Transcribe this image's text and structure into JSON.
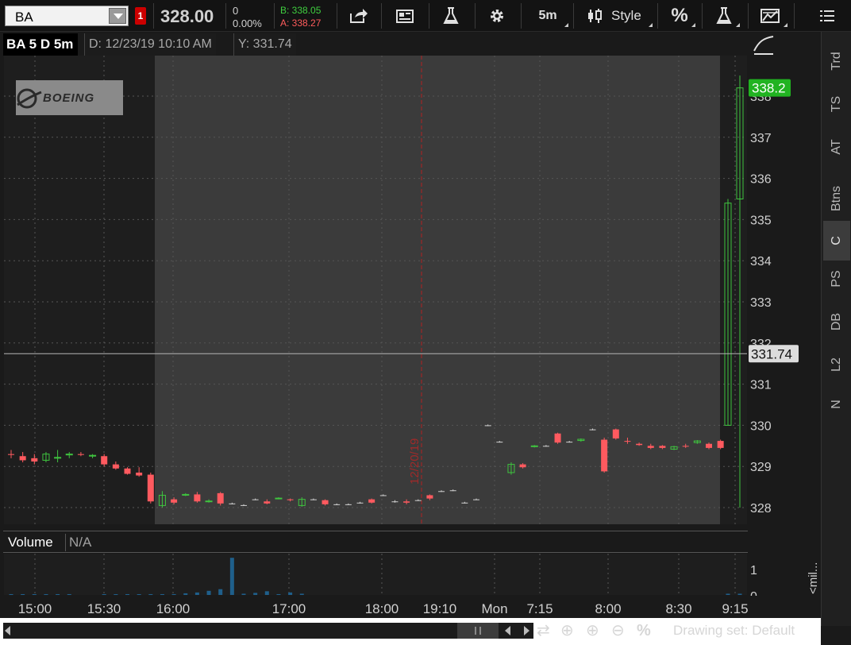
{
  "toolbar": {
    "symbol": "BA",
    "alert_count": "1",
    "last_price": "328.00",
    "net_change": "0",
    "pct_change": "0.00%",
    "bid": "B: 338.05",
    "ask": "A: 338.27",
    "timeframe_label": "5m",
    "style_label": "Style",
    "percent_label": "%",
    "icons": [
      "share-icon",
      "news-icon",
      "flask-icon",
      "gear-icon",
      "candlestick-icon",
      "percent-icon",
      "studies-icon",
      "drawings-icon",
      "menu-icon"
    ]
  },
  "chart_header": {
    "title": "BA 5 D 5m",
    "date_readout": "D: 12/23/19 10:10 AM",
    "y_readout": "Y: 331.74"
  },
  "price_panel": {
    "logo_text": "BOEING",
    "date_marker": "12/20/19",
    "last_price_label": "338.2",
    "cursor_price_label": "331.74",
    "colors": {
      "up": "#3fc43f",
      "down": "#ff5a5f",
      "last_price_bg": "#21b321",
      "cursor_label_bg": "#dcdcdc"
    }
  },
  "volume_panel": {
    "title": "Volume",
    "value": "N/A",
    "y_tick_labels": [
      "1",
      "0"
    ],
    "units_label": "<mil..."
  },
  "sidebar": {
    "tabs": [
      "Trd",
      "TS",
      "AT",
      "Btns",
      "C",
      "PS",
      "DB",
      "L2",
      "N"
    ],
    "active_tab": "C"
  },
  "bottom_bar": {
    "drawing_set_label": "Drawing set: Default",
    "icons": [
      "pan-icon",
      "crosshair-icon",
      "zoom-in-icon",
      "zoom-out-icon",
      "percent-icon"
    ]
  },
  "chart_data": {
    "type": "candlestick",
    "title": "",
    "xlabel": "",
    "ylabel": "",
    "ylim": [
      327.6,
      338.9
    ],
    "y_ticks": [
      328,
      329,
      330,
      331,
      332,
      333,
      334,
      335,
      336,
      337,
      338
    ],
    "x_tick_labels": [
      "15:00",
      "15:30",
      "16:00",
      "17:00",
      "18:00",
      "19:10",
      "Mon",
      "7:15",
      "8:00",
      "8:30",
      "9:15"
    ],
    "horizontal_line": 331.74,
    "session_regions": [
      "after-hours",
      "extended-hours"
    ],
    "candles": [
      {
        "o": 329.3,
        "h": 329.4,
        "l": 329.2,
        "c": 329.28
      },
      {
        "o": 329.25,
        "h": 329.35,
        "l": 329.1,
        "c": 329.15
      },
      {
        "o": 329.2,
        "h": 329.3,
        "l": 329.05,
        "c": 329.12
      },
      {
        "o": 329.15,
        "h": 329.35,
        "l": 329.1,
        "c": 329.3
      },
      {
        "o": 329.2,
        "h": 329.4,
        "l": 329.1,
        "c": 329.22
      },
      {
        "o": 329.28,
        "h": 329.35,
        "l": 329.2,
        "c": 329.3
      },
      {
        "o": 329.3,
        "h": 329.35,
        "l": 329.25,
        "c": 329.28
      },
      {
        "o": 329.25,
        "h": 329.3,
        "l": 329.2,
        "c": 329.27
      },
      {
        "o": 329.25,
        "h": 329.3,
        "l": 329.0,
        "c": 329.05
      },
      {
        "o": 329.05,
        "h": 329.12,
        "l": 328.92,
        "c": 328.95
      },
      {
        "o": 328.95,
        "h": 328.98,
        "l": 328.8,
        "c": 328.82
      },
      {
        "o": 328.85,
        "h": 328.98,
        "l": 328.75,
        "c": 328.78
      },
      {
        "o": 328.8,
        "h": 328.85,
        "l": 328.1,
        "c": 328.15
      },
      {
        "o": 328.05,
        "h": 328.4,
        "l": 328.0,
        "c": 328.3
      },
      {
        "o": 328.2,
        "h": 328.25,
        "l": 328.08,
        "c": 328.12
      },
      {
        "o": 328.3,
        "h": 328.35,
        "l": 328.28,
        "c": 328.32
      },
      {
        "o": 328.32,
        "h": 328.38,
        "l": 328.12,
        "c": 328.15
      },
      {
        "o": 328.15,
        "h": 328.2,
        "l": 328.12,
        "c": 328.16
      },
      {
        "o": 328.35,
        "h": 328.38,
        "l": 328.05,
        "c": 328.1
      },
      {
        "o": 328.1,
        "h": 328.12,
        "l": 328.08,
        "c": 328.1
      },
      {
        "o": 328.06,
        "h": 328.08,
        "l": 328.04,
        "c": 328.06
      },
      {
        "o": 328.2,
        "h": 328.22,
        "l": 328.18,
        "c": 328.2
      },
      {
        "o": 328.15,
        "h": 328.2,
        "l": 328.08,
        "c": 328.1
      },
      {
        "o": 328.22,
        "h": 328.25,
        "l": 328.2,
        "c": 328.23
      },
      {
        "o": 328.2,
        "h": 328.22,
        "l": 328.15,
        "c": 328.18
      },
      {
        "o": 328.05,
        "h": 328.25,
        "l": 328.02,
        "c": 328.2
      },
      {
        "o": 328.2,
        "h": 328.22,
        "l": 328.18,
        "c": 328.2
      },
      {
        "o": 328.18,
        "h": 328.2,
        "l": 328.05,
        "c": 328.08
      },
      {
        "o": 328.08,
        "h": 328.1,
        "l": 328.06,
        "c": 328.08
      },
      {
        "o": 328.08,
        "h": 328.1,
        "l": 328.06,
        "c": 328.08
      },
      {
        "o": 328.12,
        "h": 328.14,
        "l": 328.1,
        "c": 328.12
      },
      {
        "o": 328.2,
        "h": 328.22,
        "l": 328.1,
        "c": 328.12
      },
      {
        "o": 328.3,
        "h": 328.32,
        "l": 328.28,
        "c": 328.3
      },
      {
        "o": 328.15,
        "h": 328.18,
        "l": 328.12,
        "c": 328.15
      },
      {
        "o": 328.15,
        "h": 328.2,
        "l": 328.08,
        "c": 328.12
      },
      {
        "o": 328.18,
        "h": 328.2,
        "l": 328.16,
        "c": 328.18
      },
      {
        "o": 328.3,
        "h": 328.32,
        "l": 328.18,
        "c": 328.22
      },
      {
        "o": 328.4,
        "h": 328.42,
        "l": 328.38,
        "c": 328.4
      },
      {
        "o": 328.42,
        "h": 328.44,
        "l": 328.4,
        "c": 328.42
      },
      {
        "o": 328.12,
        "h": 328.14,
        "l": 328.1,
        "c": 328.12
      },
      {
        "o": 328.2,
        "h": 328.22,
        "l": 328.18,
        "c": 328.2
      },
      {
        "o": 330.0,
        "h": 330.02,
        "l": 329.98,
        "c": 330.0
      },
      {
        "o": 329.6,
        "h": 329.62,
        "l": 329.58,
        "c": 329.6
      },
      {
        "o": 328.85,
        "h": 329.1,
        "l": 328.8,
        "c": 329.05
      },
      {
        "o": 329.05,
        "h": 329.08,
        "l": 328.95,
        "c": 328.98
      },
      {
        "o": 329.48,
        "h": 329.52,
        "l": 329.46,
        "c": 329.5
      },
      {
        "o": 329.5,
        "h": 329.52,
        "l": 329.48,
        "c": 329.5
      },
      {
        "o": 329.8,
        "h": 329.82,
        "l": 329.55,
        "c": 329.58
      },
      {
        "o": 329.6,
        "h": 329.62,
        "l": 329.58,
        "c": 329.6
      },
      {
        "o": 329.63,
        "h": 329.68,
        "l": 329.6,
        "c": 329.66
      },
      {
        "o": 329.9,
        "h": 329.92,
        "l": 329.88,
        "c": 329.9
      },
      {
        "o": 329.65,
        "h": 329.7,
        "l": 328.85,
        "c": 328.88
      },
      {
        "o": 329.9,
        "h": 329.92,
        "l": 329.65,
        "c": 329.68
      },
      {
        "o": 329.62,
        "h": 329.7,
        "l": 329.55,
        "c": 329.6
      },
      {
        "o": 329.55,
        "h": 329.58,
        "l": 329.5,
        "c": 329.52
      },
      {
        "o": 329.5,
        "h": 329.55,
        "l": 329.42,
        "c": 329.45
      },
      {
        "o": 329.5,
        "h": 329.52,
        "l": 329.42,
        "c": 329.45
      },
      {
        "o": 329.42,
        "h": 329.5,
        "l": 329.4,
        "c": 329.48
      },
      {
        "o": 329.5,
        "h": 329.55,
        "l": 329.45,
        "c": 329.48
      },
      {
        "o": 329.58,
        "h": 329.64,
        "l": 329.55,
        "c": 329.62
      },
      {
        "o": 329.55,
        "h": 329.58,
        "l": 329.42,
        "c": 329.45
      },
      {
        "o": 329.62,
        "h": 329.65,
        "l": 329.42,
        "c": 329.45
      },
      {
        "o": 330.0,
        "h": 335.5,
        "l": 330.0,
        "c": 335.4
      },
      {
        "o": 335.5,
        "h": 338.5,
        "l": 328.0,
        "c": 338.2
      }
    ],
    "volume": [
      0.02,
      0.02,
      0.01,
      0.02,
      0.02,
      0.02,
      0,
      0,
      0.01,
      0.01,
      0.02,
      0.01,
      0.02,
      0.02,
      0.02,
      0.04,
      0.06,
      0.1,
      0.14,
      0.9,
      0.03,
      0.05,
      0.09,
      0.02,
      0.06,
      0.03,
      0,
      0,
      0,
      0,
      0,
      0,
      0,
      0,
      0,
      0,
      0,
      0,
      0,
      0,
      0,
      0,
      0,
      0,
      0,
      0,
      0,
      0,
      0,
      0,
      0,
      0,
      0,
      0,
      0,
      0,
      0,
      0,
      0,
      0,
      0,
      0,
      0.03,
      0.03
    ]
  }
}
